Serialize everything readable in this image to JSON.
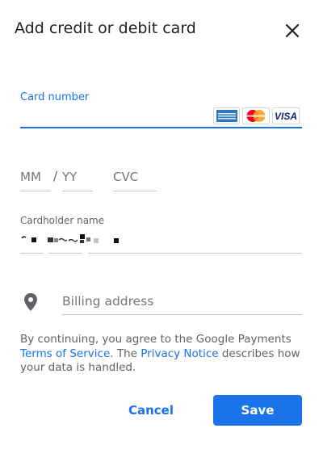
{
  "dialog": {
    "title": "Add credit or debit card"
  },
  "card_number": {
    "label": "Card number",
    "value": "",
    "brands": [
      "AMEX",
      "MasterCard",
      "VISA"
    ]
  },
  "expiry": {
    "month_placeholder": "MM",
    "separator": "/",
    "year_placeholder": "YY"
  },
  "cvc": {
    "placeholder": "CVC"
  },
  "cardholder": {
    "label": "Cardholder name"
  },
  "billing": {
    "placeholder": "Billing address"
  },
  "legal": {
    "prefix": "By continuing, you agree to the Google Payments",
    "terms_link": "Terms of Service",
    "middle": ". The",
    "privacy_link": "Privacy Notice",
    "suffix": "describes how your data is handled."
  },
  "actions": {
    "cancel_label": "Cancel",
    "save_label": "Save"
  },
  "colors": {
    "accent": "#1a73e8",
    "amex": "#2e77bb",
    "mastercard_red": "#eb001b",
    "mastercard_orange": "#f79e1b",
    "visa": "#1a1f71"
  },
  "icons": {
    "close": "close-icon",
    "location": "location-pin-icon"
  }
}
